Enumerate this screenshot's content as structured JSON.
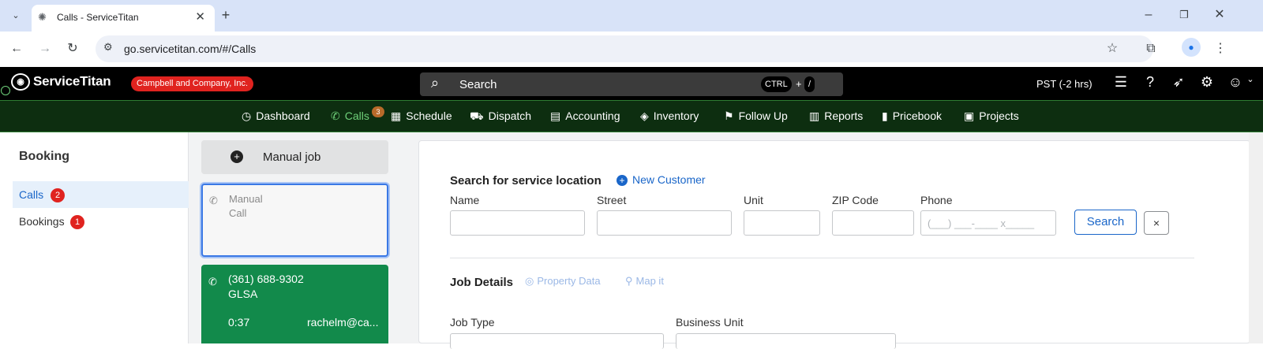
{
  "browser": {
    "tab_title": "Calls - ServiceTitan",
    "url": "go.servicetitan.com/#/Calls"
  },
  "app": {
    "logo_text": "ServiceTitan",
    "company": "Campbell and Company, Inc.",
    "search_placeholder": "Search",
    "search_kbd_1": "CTRL",
    "search_kbd_plus": "+",
    "search_kbd_2": "/",
    "timezone": "PST (-2 hrs)"
  },
  "nav": {
    "items": [
      {
        "label": "Dashboard",
        "icon": "dashboard-icon"
      },
      {
        "label": "Calls",
        "icon": "phone-icon",
        "badge": "3",
        "active": true
      },
      {
        "label": "Schedule",
        "icon": "calendar-icon"
      },
      {
        "label": "Dispatch",
        "icon": "truck-icon"
      },
      {
        "label": "Accounting",
        "icon": "clipboard-icon"
      },
      {
        "label": "Inventory",
        "icon": "box-icon"
      },
      {
        "label": "Follow Up",
        "icon": "flag-icon"
      },
      {
        "label": "Reports",
        "icon": "chart-icon"
      },
      {
        "label": "Pricebook",
        "icon": "book-icon"
      },
      {
        "label": "Projects",
        "icon": "folder-icon"
      }
    ]
  },
  "sidebar": {
    "heading": "Booking",
    "items": [
      {
        "label": "Calls",
        "count": "2",
        "active": true
      },
      {
        "label": "Bookings",
        "count": "1"
      }
    ]
  },
  "middle": {
    "manual_job_label": "Manual job",
    "manual_call_line1": "Manual",
    "manual_call_line2": "Call",
    "active_call": {
      "phone": "(361) 688-9302",
      "name": "GLSA",
      "duration": "0:37",
      "agent": "rachelm@ca..."
    }
  },
  "main": {
    "search_heading": "Search for service location",
    "new_customer": "New Customer",
    "fields": {
      "name": "Name",
      "street": "Street",
      "unit": "Unit",
      "zip": "ZIP Code",
      "phone": "Phone",
      "phone_placeholder": "(___) ___-____ x_____"
    },
    "search_button": "Search",
    "clear_button": "×",
    "job_heading": "Job Details",
    "property_data": "Property Data",
    "map_it": "Map it",
    "job_type": "Job Type",
    "business_unit": "Business Unit"
  }
}
